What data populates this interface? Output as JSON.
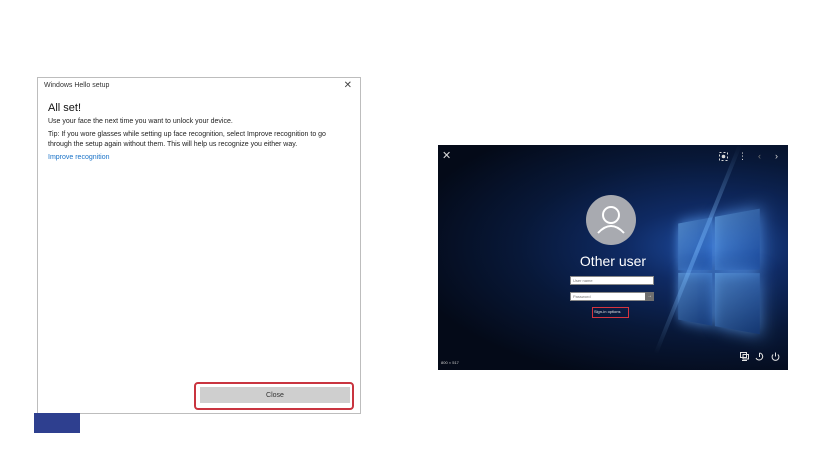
{
  "dialog": {
    "title": "Windows Hello setup",
    "close_glyph": "✕",
    "heading": "All set!",
    "message": "Use your face the next time you want to unlock your device.",
    "tip": "Tip: If you wore glasses while setting up face recognition, select Improve recognition to go through the setup again without them. This will help us recognize you either way.",
    "improve_link": "Improve recognition",
    "close_button": "Close",
    "highlight_color": "#c9343f"
  },
  "login_screen": {
    "top_bar": {
      "close_icon": "close-icon",
      "capture_icon": "screenshot-icon",
      "menu_icon": "more-options-icon",
      "prev_icon": "chevron-left-icon",
      "next_icon": "chevron-right-icon"
    },
    "user_name": "Other user",
    "username_placeholder": "User name",
    "password_placeholder": "Password",
    "submit_glyph": "→",
    "sign_in_options": "Sign-in options",
    "resolution_label": "800 × 517",
    "bottom_icons": [
      "network-icon",
      "ease-of-access-icon",
      "power-icon"
    ]
  },
  "colors": {
    "link": "#1a73c8",
    "tab_blue": "#2e3f8f",
    "login_bg": "#081838"
  }
}
